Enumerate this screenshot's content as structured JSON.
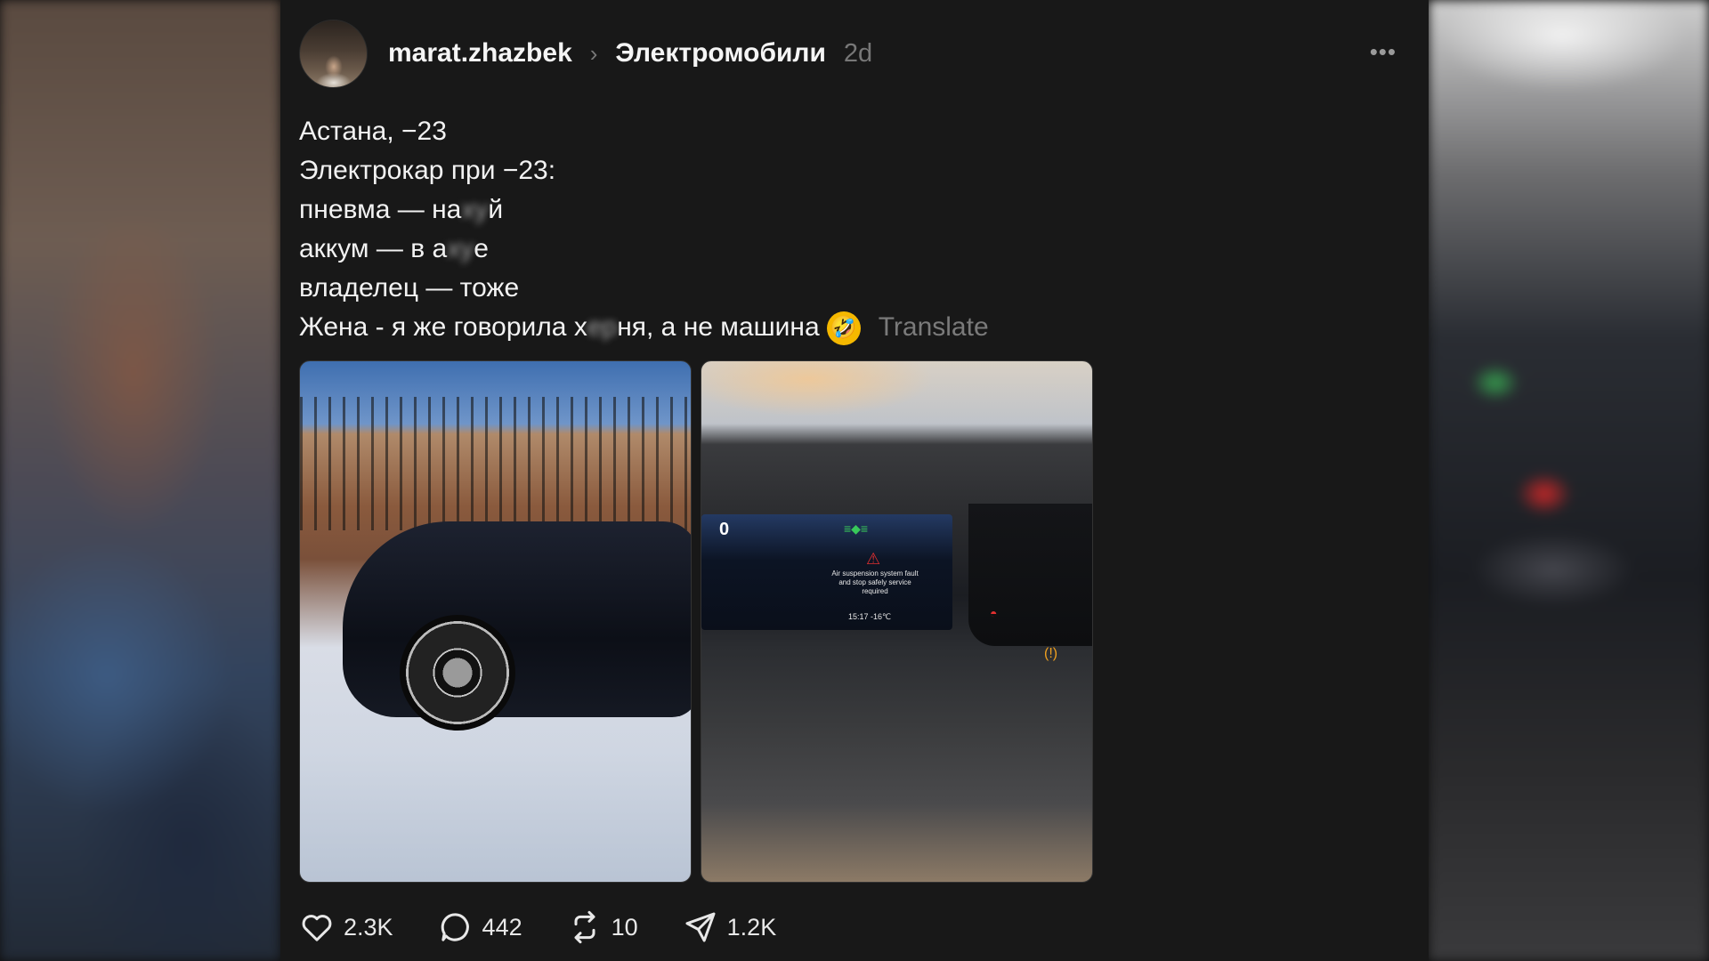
{
  "post": {
    "username": "marat.zhazbek",
    "community": "Электромобили",
    "timestamp": "2d",
    "more_label": "•••",
    "lines": [
      {
        "pre": "Астана, −23",
        "censored": "",
        "post": ""
      },
      {
        "pre": "Электрокар при −23:",
        "censored": "",
        "post": ""
      },
      {
        "pre": "пневма — на",
        "censored": "ху",
        "post": "й"
      },
      {
        "pre": "аккум — в а",
        "censored": "ху",
        "post": "е"
      },
      {
        "pre": "владелец — тоже",
        "censored": "",
        "post": ""
      },
      {
        "pre": "Жена - я же говорила х",
        "censored": "ер",
        "post": "ня, а не машина"
      }
    ],
    "emoji": "🤣",
    "translate_label": "Translate",
    "photo2_screen": {
      "speed": "0",
      "warning": "Air suspension system fault and stop safely service required",
      "time_temp": "15:17  -16℃"
    }
  },
  "actions": {
    "likes": "2.3K",
    "comments": "442",
    "reposts": "10",
    "shares": "1.2K"
  },
  "icons": {
    "like": "heart-icon",
    "comment": "comment-icon",
    "repost": "repost-icon",
    "share": "share-icon",
    "more": "more-icon"
  }
}
